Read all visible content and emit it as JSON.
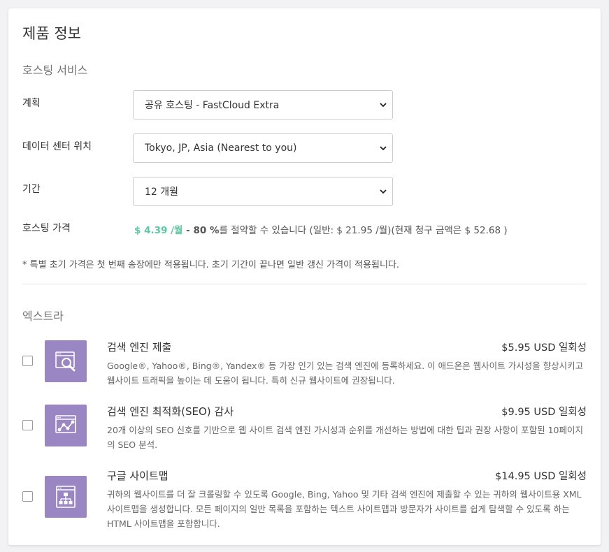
{
  "page_title": "제품 정보",
  "hosting_section": {
    "title": "호스팅 서비스",
    "plan": {
      "label": "계획",
      "value": "공유 호스팅 - FastCloud Extra"
    },
    "datacenter": {
      "label": "데이터 센터 위치",
      "value": "Tokyo, JP, Asia (Nearest to you)"
    },
    "period": {
      "label": "기간",
      "value": "12 개월"
    },
    "price": {
      "label": "호스팅 가격",
      "amount": "$ 4.39 /월",
      "separator": " - ",
      "discount": "80 %",
      "text_after": "를 절약할 수 있습니다 (일반: $ 21.95 /월)(현재 청구 금액은 $ 52.68 )"
    },
    "note": "* 특별 초기 가격은 첫 번째 송장에만 적용됩니다. 초기 기간이 끝나면 일반 갱신 가격이 적용됩니다."
  },
  "extras_section": {
    "title": "엑스트라",
    "items": [
      {
        "name": "검색 엔진 제출",
        "price": "$5.95 USD 일회성",
        "description": "Google®, Yahoo®, Bing®, Yandex® 등 가장 인기 있는 검색 엔진에 등록하세요. 이 애드온은 웹사이트 가시성을 향상시키고 웹사이트 트래픽을 높이는 데 도움이 됩니다. 특히 신규 웹사이트에 권장됩니다.",
        "icon": "search-submission-icon"
      },
      {
        "name": "검색 엔진 최적화(SEO) 감사",
        "price": "$9.95 USD 일회성",
        "description": "20개 이상의 SEO 신호를 기반으로 웹 사이트 검색 엔진 가시성과 순위를 개선하는 방법에 대한 팁과 권장 사항이 포함된 10페이지의 SEO 분석.",
        "icon": "seo-graph-icon"
      },
      {
        "name": "구글 사이트맵",
        "price": "$14.95 USD 일회성",
        "description": "귀하의 웹사이트를 더 잘 크롤링할 수 있도록 Google, Bing, Yahoo 및 기타 검색 엔진에 제출할 수 있는 귀하의 웹사이트용 XML 사이트맵을 생성합니다. 모든 페이지의 일반 목록을 포함하는 텍스트 사이트맵과 방문자가 사이트를 쉽게 탐색할 수 있도록 하는 HTML 사이트맵을 포함합니다.",
        "icon": "sitemap-icon"
      }
    ]
  },
  "colors": {
    "accent_green": "#5cc7a0",
    "icon_purple": "#9b86c4"
  }
}
